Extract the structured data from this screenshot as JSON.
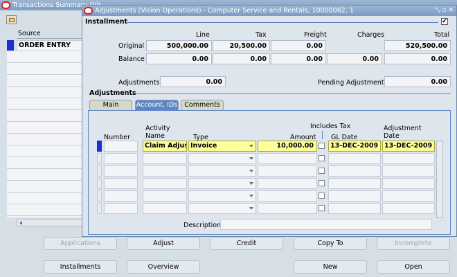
{
  "back_window": {
    "title": "Transactions Summary (Vis...",
    "column_header": "Source",
    "first_row": "ORDER ENTRY"
  },
  "dialog": {
    "title": "Adjustments (Vision Operations) - Computer Service and Rentals, 10000062, 1",
    "installment": {
      "section_label": "Installment",
      "checkbox_checked": true,
      "columns": [
        "Line",
        "Tax",
        "Freight",
        "Charges",
        "Total"
      ],
      "rows": [
        {
          "label": "Original",
          "values": [
            "500,000.00",
            "20,500.00",
            "0.00",
            "",
            "520,500.00"
          ]
        },
        {
          "label": "Balance",
          "values": [
            "0.00",
            "0.00",
            "0.00",
            "0.00",
            "0.00"
          ]
        }
      ],
      "adjustments_label": "Adjustments",
      "adjustments_value": "0.00",
      "pending_label": "Pending Adjustments",
      "pending_value": "0.00"
    },
    "adjustments": {
      "section_label": "Adjustments",
      "tabs": [
        {
          "label": "Main",
          "active": false
        },
        {
          "label": "Account, IDs",
          "active": true
        },
        {
          "label": "Comments",
          "active": false
        }
      ],
      "headers": {
        "number": "Number",
        "activity_name": "Activity Name",
        "type": "Type",
        "amount": "Amount",
        "includes_tax": "Includes Tax",
        "gl_date": "GL Date",
        "adjustment_date": "Adjustment Date"
      },
      "rows": [
        {
          "number": "",
          "activity": "Claim Adjustm",
          "type": "Invoice",
          "amount": "10,000.00",
          "includes_tax": false,
          "gl_date": "13-DEC-2009",
          "adj_date": "13-DEC-2009"
        },
        {
          "number": "",
          "activity": "",
          "type": "",
          "amount": "",
          "includes_tax": false,
          "gl_date": "",
          "adj_date": ""
        },
        {
          "number": "",
          "activity": "",
          "type": "",
          "amount": "",
          "includes_tax": false,
          "gl_date": "",
          "adj_date": ""
        },
        {
          "number": "",
          "activity": "",
          "type": "",
          "amount": "",
          "includes_tax": false,
          "gl_date": "",
          "adj_date": ""
        },
        {
          "number": "",
          "activity": "",
          "type": "",
          "amount": "",
          "includes_tax": false,
          "gl_date": "",
          "adj_date": ""
        },
        {
          "number": "",
          "activity": "",
          "type": "",
          "amount": "",
          "includes_tax": false,
          "gl_date": "",
          "adj_date": ""
        }
      ],
      "description_label": "Description",
      "description_value": ""
    }
  },
  "buttons": {
    "row1": [
      {
        "label": "Applications",
        "enabled": false
      },
      {
        "label": "Adjust",
        "enabled": true
      },
      {
        "label": "Credit",
        "enabled": true
      },
      {
        "label": "Copy To",
        "enabled": true
      },
      {
        "label": "Incomplete",
        "enabled": false
      }
    ],
    "row2": [
      {
        "label": "Installments",
        "enabled": true
      },
      {
        "label": "Overview",
        "enabled": true
      },
      {
        "label": "New",
        "enabled": true
      },
      {
        "label": "Open",
        "enabled": true
      }
    ]
  },
  "colors": {
    "title_blue": "#7b9cc4",
    "active_tab": "#5b86c6",
    "current_field": "#ffff99",
    "record_indicator": "#1a2fd8"
  }
}
